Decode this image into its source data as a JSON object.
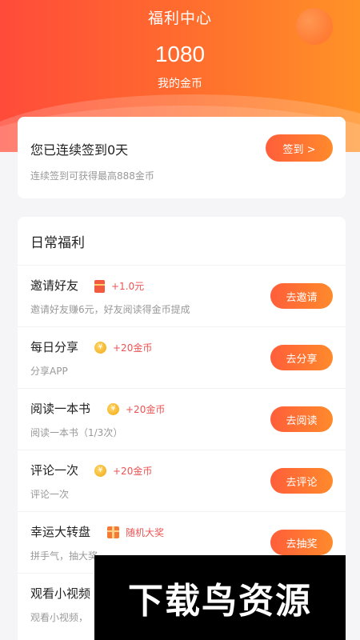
{
  "header": {
    "title": "福利中心",
    "coins": "1080",
    "coins_label": "我的金币"
  },
  "checkin": {
    "title": "您已连续签到0天",
    "subtitle": "连续签到可获得最高888金币",
    "button": "签到 >"
  },
  "daily": {
    "title": "日常福利",
    "tasks": [
      {
        "name": "邀请好友",
        "icon": "red-packet-icon",
        "reward": "+1.0元",
        "desc": "邀请好友赚6元，好友阅读得金币提成",
        "button": "去邀请"
      },
      {
        "name": "每日分享",
        "icon": "coin-icon",
        "reward": "+20金币",
        "desc": "分享APP",
        "button": "去分享"
      },
      {
        "name": "阅读一本书",
        "icon": "coin-icon",
        "reward": "+20金币",
        "desc": "阅读一本书（1/3次）",
        "button": "去阅读"
      },
      {
        "name": "评论一次",
        "icon": "coin-icon",
        "reward": "+20金币",
        "desc": "评论一次",
        "button": "去评论"
      },
      {
        "name": "幸运大转盘",
        "icon": "gift-icon",
        "reward": "随机大奖",
        "desc": "拼手气，抽大奖",
        "button": "去抽奖"
      },
      {
        "name": "观看小视频",
        "icon": "",
        "reward": "",
        "desc": "观看小视频，",
        "button": ""
      }
    ]
  },
  "watermark": "下载鸟资源",
  "colors": {
    "accent_start": "#ff5e3a",
    "accent_end": "#ff8a2b",
    "reward_red": "#ee5353"
  }
}
